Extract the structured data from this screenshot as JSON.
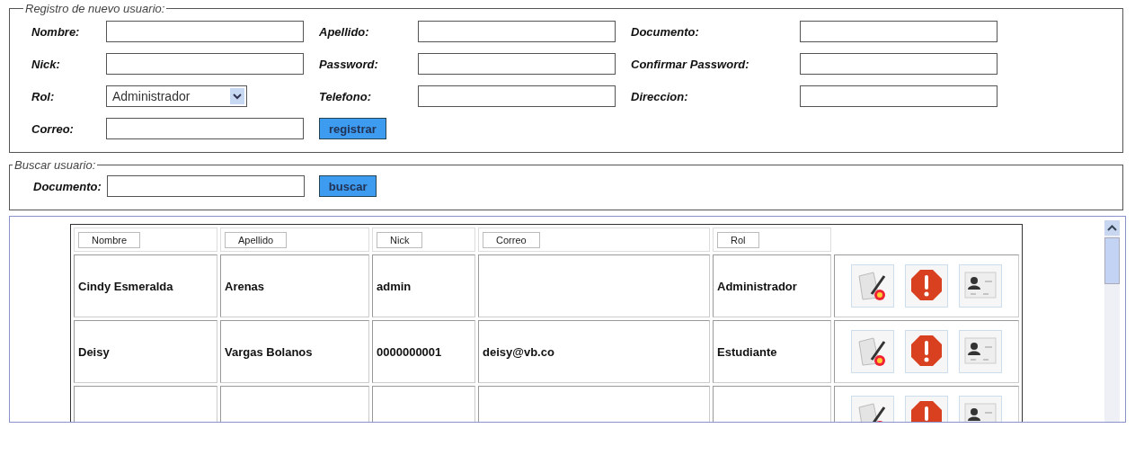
{
  "registration": {
    "legend": "Registro de nuevo usuario:",
    "rows": [
      [
        {
          "label": "Nombre:",
          "kind": "input"
        },
        {
          "label": "Apellido:",
          "kind": "input"
        },
        {
          "label": "Documento:",
          "kind": "input"
        }
      ],
      [
        {
          "label": "Nick:",
          "kind": "input"
        },
        {
          "label": "Password:",
          "kind": "input"
        },
        {
          "label": "Confirmar Password:",
          "kind": "input"
        }
      ],
      [
        {
          "label": "Rol:",
          "kind": "select",
          "value": "Administrador"
        },
        {
          "label": "Telefono:",
          "kind": "input"
        },
        {
          "label": "Direccion:",
          "kind": "input"
        }
      ],
      [
        {
          "label": "Correo:",
          "kind": "input"
        },
        {
          "label": "registrar",
          "kind": "button"
        }
      ]
    ]
  },
  "search": {
    "legend": "Buscar usuario:",
    "label": "Documento:",
    "button": "buscar"
  },
  "table": {
    "columns": [
      "Nombre",
      "Apellido",
      "Nick",
      "Correo",
      "Rol"
    ],
    "rows": [
      {
        "cut_off": false,
        "cells": [
          "Cindy Esmeralda",
          "Arenas",
          "admin",
          null,
          "Administrador"
        ]
      },
      {
        "cut_off": false,
        "cells": [
          "Deisy",
          "Vargas Bolanos",
          "0000000001",
          "deisy@vb.co",
          "Estudiante"
        ]
      },
      {
        "cut_off": true
      }
    ]
  }
}
